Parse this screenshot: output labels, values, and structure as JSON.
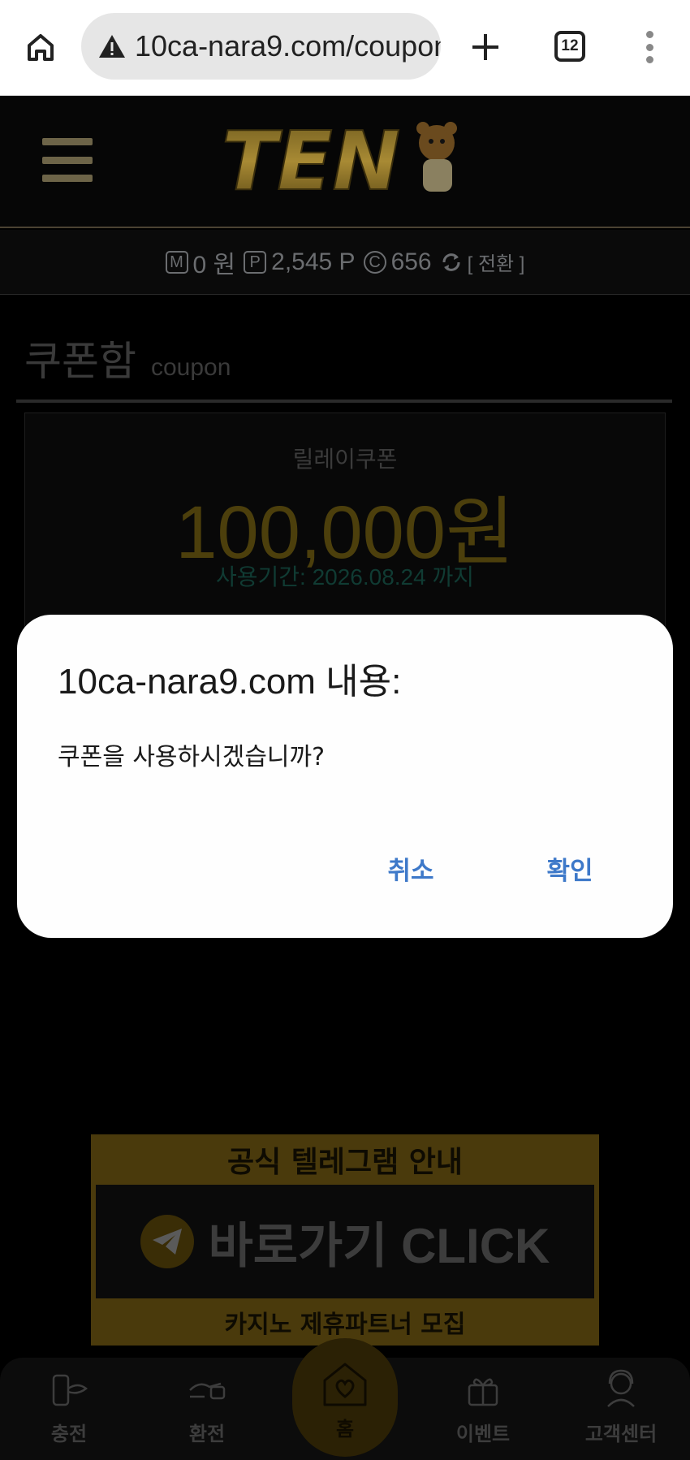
{
  "browser": {
    "url": "10ca-nara9.com/coupon",
    "tab_count": "12"
  },
  "site": {
    "logo_text": "TEN",
    "balance": {
      "money_icon": "M",
      "money": "0 원",
      "point_icon": "P",
      "points": "2,545 P",
      "comp_icon": "C",
      "comp": "656",
      "swap_label": "[ 전환 ]"
    },
    "page_title": "쿠폰함",
    "page_title_en": "coupon"
  },
  "coupon": {
    "name": "릴레이쿠폰",
    "amount": "100,000원",
    "expire": "사용기간: 2026.08.24 까지"
  },
  "banner": {
    "top": "공식 텔레그램 안내",
    "middle": "바로가기 CLICK",
    "bottom": "카지노 제휴파트너 모집"
  },
  "dialog": {
    "title": "10ca-nara9.com 내용:",
    "message": "쿠폰을 사용하시겠습니까?",
    "cancel": "취소",
    "ok": "확인"
  },
  "bottom_nav": {
    "charge": "충전",
    "exchange": "환전",
    "home": "홈",
    "event": "이벤트",
    "support": "고객센터"
  },
  "colors": {
    "dialog_button": "#3e79c9",
    "coupon_amount": "#4c3f0c",
    "background": "#000000"
  }
}
